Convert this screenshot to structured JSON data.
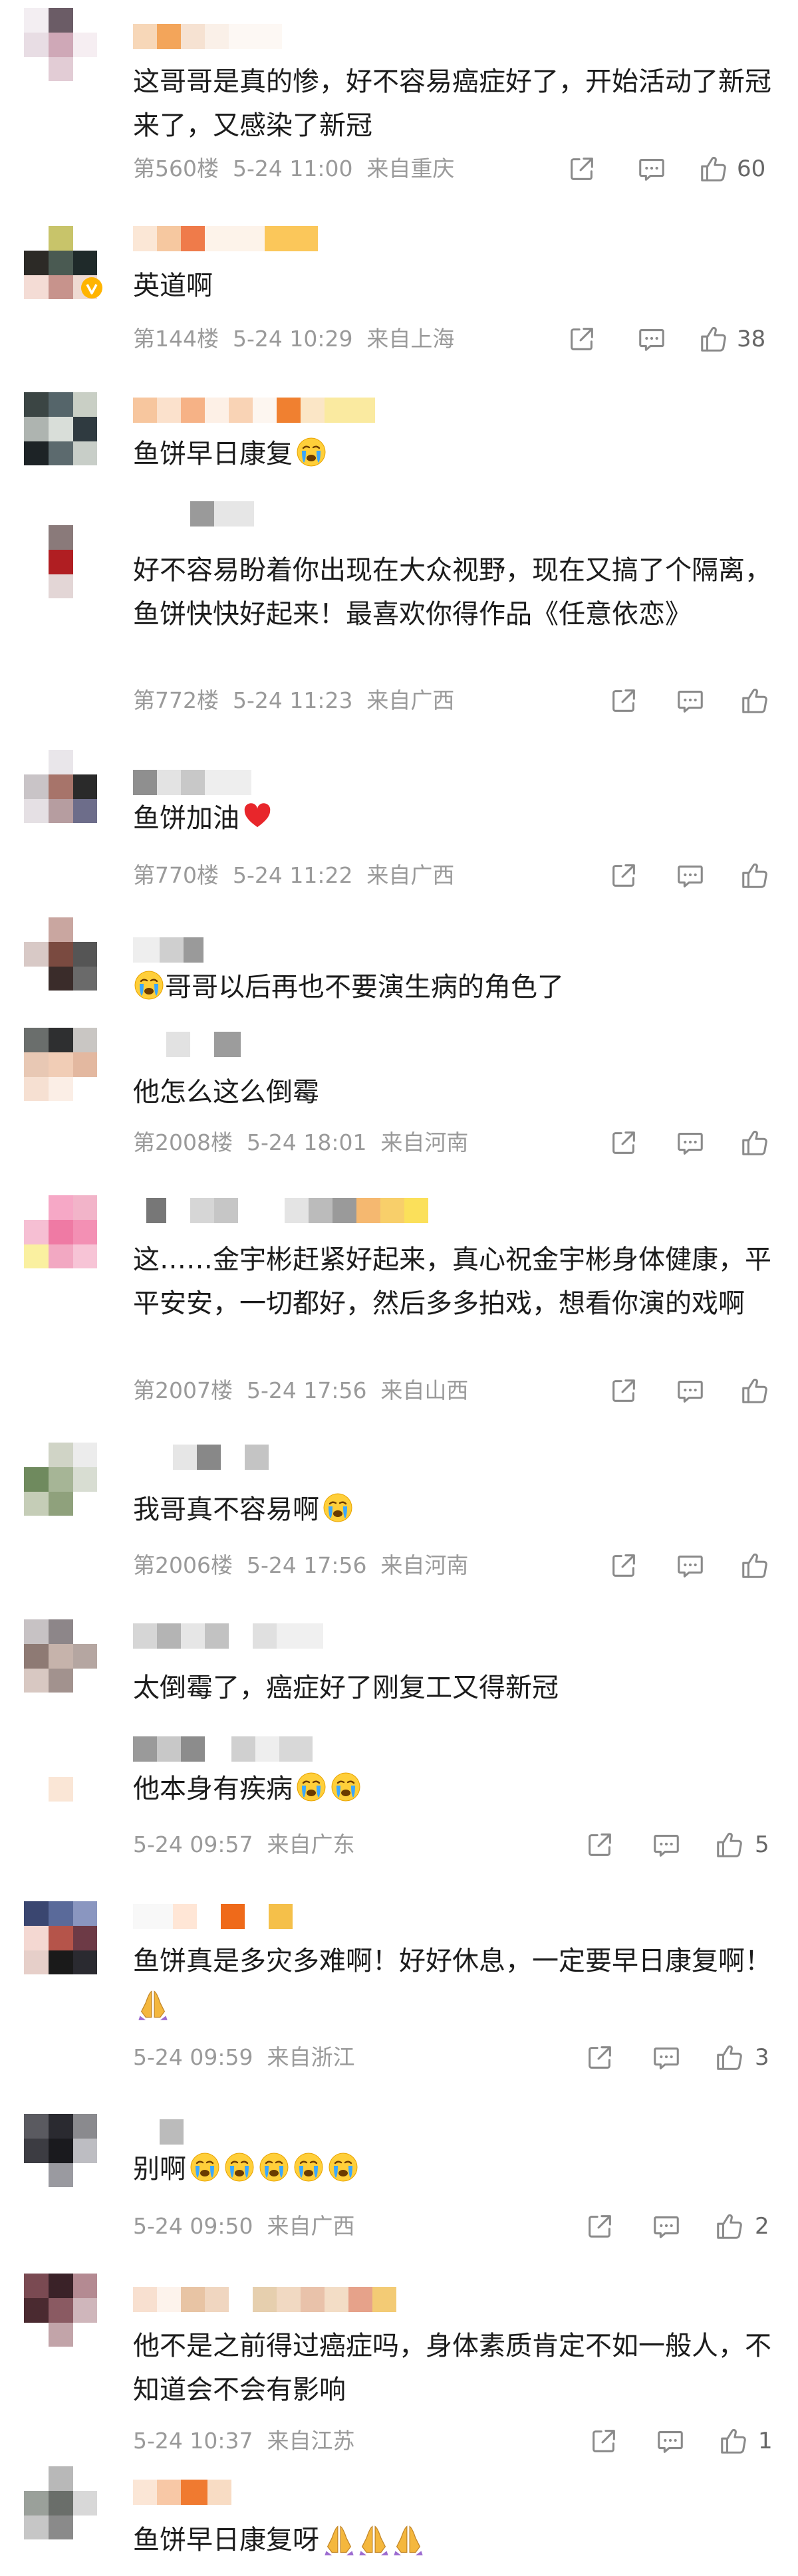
{
  "colors": {
    "meta": "#9a9a9a",
    "icon": "#8a8a8a",
    "text": "#1c1c1c",
    "heart": "#e8262b"
  },
  "icons": {
    "share": "share-icon",
    "reply": "comment-icon",
    "like": "thumbs-up-icon",
    "cry": "crying-face-emoji",
    "heart": "red-heart-emoji",
    "pray": "folded-hands-emoji"
  },
  "comments": [
    {
      "text": "这哥哥是真的惨，好不容易癌症好了，开始活动了新冠来了，又感染了新冠",
      "meta": "第560楼  5-24 11:00  来自重庆",
      "likes": "60"
    },
    {
      "text": "英道啊",
      "meta": "第144楼  5-24 10:29  来自上海",
      "likes": "38"
    },
    {
      "text": "鱼饼早日康复",
      "meta": ""
    },
    {
      "text": "好不容易盼着你出现在大众视野，现在又搞了个隔离，鱼饼快快好起来！最喜欢你得作品《任意依恋》",
      "meta": "第772楼  5-24 11:23  来自广西",
      "likes": ""
    },
    {
      "text": "鱼饼加油",
      "meta": "第770楼  5-24 11:22  来自广西",
      "likes": ""
    },
    {
      "text": "哥哥以后再也不要演生病的角色了",
      "meta": ""
    },
    {
      "text": "他怎么这么倒霉",
      "meta": "第2008楼  5-24 18:01  来自河南",
      "likes": ""
    },
    {
      "text": "这……金宇彬赶紧好起来，真心祝金宇彬身体健康，平平安安，一切都好，然后多多拍戏，想看你演的戏啊",
      "meta": "第2007楼  5-24 17:56  来自山西",
      "likes": ""
    },
    {
      "text": "我哥真不容易啊",
      "meta": "第2006楼  5-24 17:56  来自河南",
      "likes": ""
    },
    {
      "text": "太倒霉了，癌症好了刚复工又得新冠",
      "meta": ""
    },
    {
      "text": "他本身有疾病",
      "meta": "5-24 09:57  来自广东",
      "likes": "5"
    },
    {
      "text": "鱼饼真是多灾多难啊！好好休息，一定要早日康复啊！",
      "meta": "5-24 09:59  来自浙江",
      "likes": "3"
    },
    {
      "text": "别啊",
      "meta": "5-24 09:50  来自广西",
      "likes": "2"
    },
    {
      "text": "他不是之前得过癌症吗，身体素质肯定不如一般人，不知道会不会有影响",
      "meta": "5-24 10:37  来自江苏",
      "likes": "1"
    },
    {
      "text": "鱼饼早日康复呀",
      "meta": ""
    }
  ]
}
